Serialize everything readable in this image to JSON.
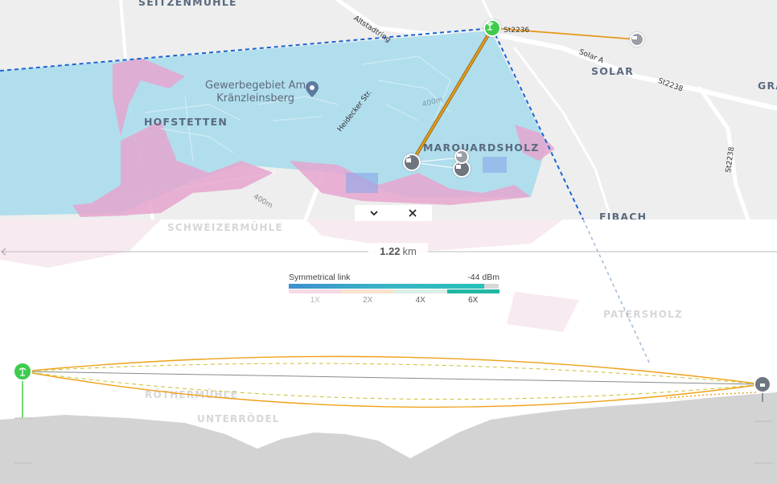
{
  "map": {
    "places": {
      "seitzenmuehle": "SEITZENMÜHLE",
      "hofstetten": "HOFSTETTEN",
      "marquardsholz": "MARQUARDSHOLZ",
      "solar": "SOLAR",
      "gra": "GRA",
      "fibach": "FIBACH"
    },
    "poi": {
      "line1": "Gewerbegebiet Am",
      "line2": "Kränzleinsberg"
    },
    "roads": {
      "altstadtring": "Altstadtring",
      "heidecker": "Heidecker Str.",
      "st2236": "St2236",
      "st2238_a": "St2238",
      "st2238_b": "St2238",
      "solar_a": "Solar A",
      "contour_400a": "400m",
      "contour_400b": "400m"
    },
    "colors": {
      "coverage_blue": "#a9dcec",
      "coverage_pink": "#e6a6cf",
      "link_orange": "#e69a1e",
      "sector_blue": "#1a66d1",
      "node_green": "#3ecb4e",
      "node_gray": "#6f7680"
    },
    "icons": {
      "poi": "location-pin-icon",
      "tower": "antenna-icon",
      "station": "cpe-icon"
    }
  },
  "panel": {
    "collapse_icon": "chevron-down-icon",
    "close_icon": "close-icon",
    "distance": {
      "value": "1.22",
      "unit": "km"
    },
    "legend": {
      "title": "Symmetrical link",
      "value": "-44 dBm",
      "signal_fraction": 0.93,
      "modes": [
        "1X",
        "2X",
        "4X",
        "6X"
      ],
      "mode_colors": [
        "#f6d9e9",
        "#fbe2cf",
        "#d9efe8",
        "#22b6a3"
      ]
    },
    "ghost_places": {
      "schweizermuehle": "SCHWEIZERMÜHLE",
      "patersholz": "PATERSHOLZ",
      "rothermuehle": "RÖTHERMÜHLE",
      "unterroedel": "UNTERRÖDEL"
    },
    "profile": {
      "fresnel_color": "#f0a018",
      "terrain_color": "#d3d3d3",
      "los_color": "#8a8a8a"
    }
  }
}
